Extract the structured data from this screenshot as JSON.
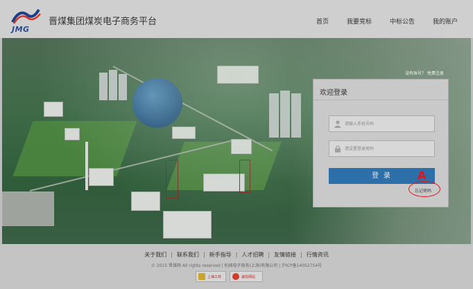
{
  "header": {
    "logo_text": "JMG",
    "site_title": "晋煤集团煤炭电子商务平台",
    "nav": [
      "首页",
      "我要竞标",
      "中标公告",
      "我的账户"
    ]
  },
  "banner": {
    "register_prompt": "没有账号？ 免费注册"
  },
  "login": {
    "title": "欢迎登录",
    "username_placeholder": "请输入手机号码",
    "password_placeholder": "请设置登录密码",
    "submit_label": "登 录",
    "forgot_label": "忘记密码",
    "annotation_label": "A",
    "annotation_color": "#e0141a"
  },
  "footer": {
    "links": [
      "关于我们",
      "联系我们",
      "新手指导",
      "人才招聘",
      "友情链接",
      "行情资讯"
    ],
    "copyright": "© 2015 晋煤网 All rights reserved   |   机械电子商务(上海)有限公司   |   沪ICP备14052754号",
    "badges": [
      "上海工商",
      "诚信网站"
    ]
  },
  "colors": {
    "primary_button": "#2d6fa8",
    "header_bg": "#cfcfcf"
  }
}
